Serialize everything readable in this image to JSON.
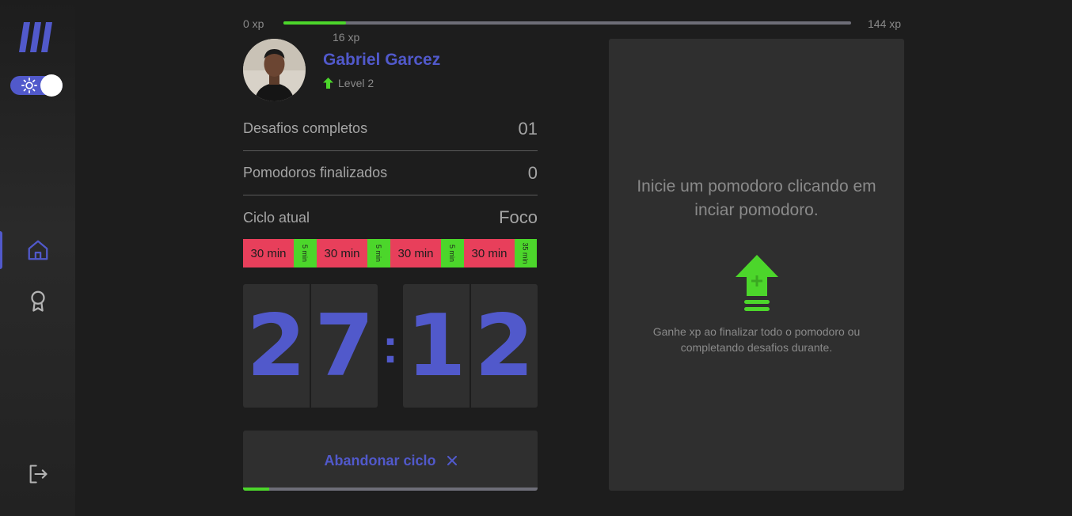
{
  "sidebar": {
    "logo_icon": "brand-logo",
    "theme_toggle": {
      "icon": "sun-icon",
      "state": "on"
    },
    "nav": [
      {
        "icon": "home-icon",
        "active": true
      },
      {
        "icon": "award-icon",
        "active": false
      }
    ],
    "logout_icon": "logout-icon"
  },
  "xp": {
    "min_label": "0 xp",
    "max_label": "144 xp",
    "current_label": "16 xp",
    "progress": 0.11
  },
  "profile": {
    "name": "Gabriel Garcez",
    "level_label": "Level 2",
    "level_icon": "level-up-arrow-icon"
  },
  "stats": [
    {
      "label": "Desafios completos",
      "value": "01"
    },
    {
      "label": "Pomodoros finalizados",
      "value": "0"
    },
    {
      "label": "Ciclo atual",
      "value": "Foco"
    }
  ],
  "cycle": [
    {
      "type": "focus",
      "label": "30 min"
    },
    {
      "type": "break",
      "label": "5 min"
    },
    {
      "type": "focus",
      "label": "30 min"
    },
    {
      "type": "break",
      "label": "5 min"
    },
    {
      "type": "focus",
      "label": "30 min"
    },
    {
      "type": "break",
      "label": "5 min"
    },
    {
      "type": "focus",
      "label": "30 min"
    },
    {
      "type": "long-break",
      "label": "35 min"
    }
  ],
  "timer": {
    "min_tens": "2",
    "min_ones": "7",
    "separator": ":",
    "sec_tens": "1",
    "sec_ones": "2"
  },
  "abandon": {
    "label": "Abandonar ciclo",
    "icon": "close-icon",
    "progress": 0.09
  },
  "card": {
    "title": "Inicie um pomodoro clicando em inciar pomodoro.",
    "icon": "level-up-icon",
    "text": "Ganhe xp ao finalizar todo o pomodoro ou completando desafios durante."
  },
  "colors": {
    "accent": "#5159cb",
    "green": "#4cd62b",
    "red": "#e83f5b",
    "background": "#1d1d1d",
    "card": "#2f2f2f"
  }
}
